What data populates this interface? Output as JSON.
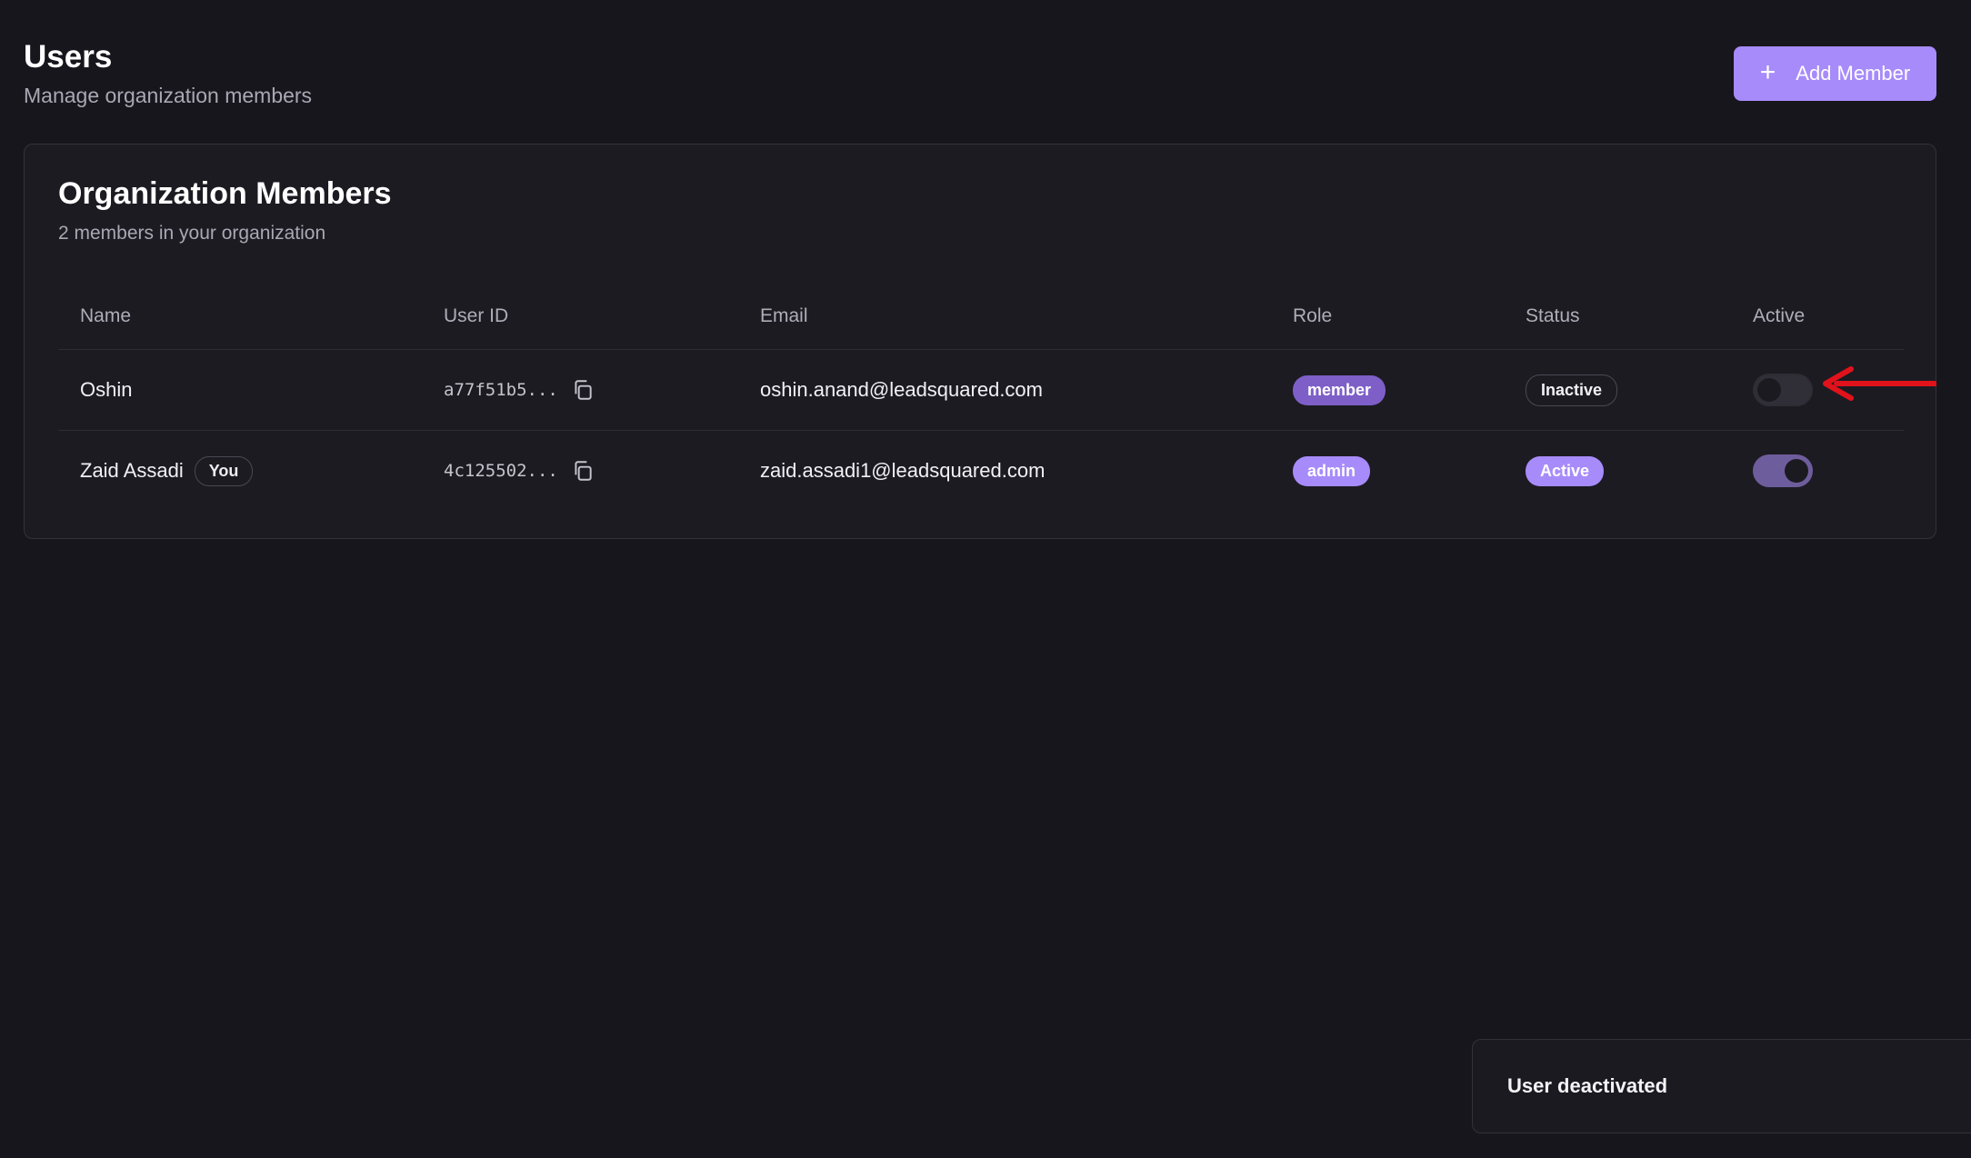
{
  "header": {
    "title": "Users",
    "subtitle": "Manage organization members",
    "add_button_label": "Add Member"
  },
  "members_card": {
    "title": "Organization Members",
    "subtitle": "2 members in your organization",
    "columns": [
      "Name",
      "User ID",
      "Email",
      "Role",
      "Status",
      "Active"
    ],
    "rows": [
      {
        "name": "Oshin",
        "you_badge": "",
        "user_id": "a77f51b5...",
        "email": "oshin.anand@leadsquared.com",
        "role": "member",
        "status": "Inactive",
        "active": false
      },
      {
        "name": "Zaid Assadi",
        "you_badge": "You",
        "user_id": "4c125502...",
        "email": "zaid.assadi1@leadsquared.com",
        "role": "admin",
        "status": "Active",
        "active": true
      }
    ]
  },
  "toast": {
    "message": "User deactivated"
  },
  "colors": {
    "background": "#17161d",
    "card": "#1c1b22",
    "accent": "#a78bfa",
    "member_badge": "#7e5fc8",
    "annotation_arrow": "#e0121b"
  },
  "icons": {
    "add": "plus-icon",
    "copy": "copy-icon",
    "annotation": "arrow-left-icon"
  }
}
